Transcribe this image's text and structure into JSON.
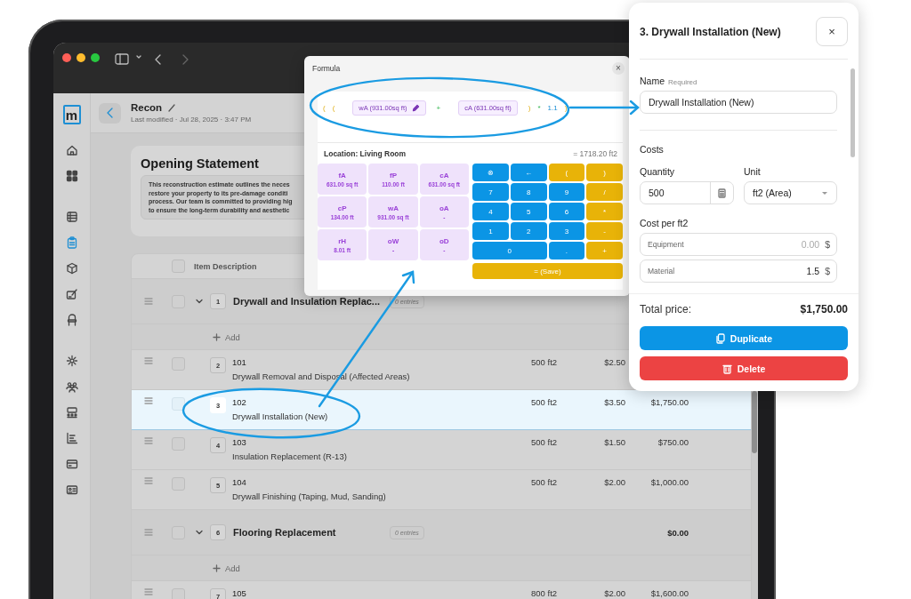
{
  "sidebar": {
    "logo": "m",
    "items": [
      {
        "selected": false
      },
      {
        "selected": false
      },
      {
        "selected": false
      },
      {
        "selected": true
      },
      {
        "selected": false
      },
      {
        "selected": false
      },
      {
        "selected": false
      },
      {
        "selected": false
      },
      {
        "selected": false
      },
      {
        "selected": false
      },
      {
        "selected": false
      },
      {
        "selected": false
      },
      {
        "selected": false
      }
    ]
  },
  "header": {
    "title": "Recon",
    "subtitle": "Last modified · Jul 28, 2025 · 3:47 PM"
  },
  "opening_statement": {
    "title": "Opening Statement",
    "lines": [
      "This reconstruction estimate outlines the neces",
      "restore your property to its pre-damage conditi",
      "process. Our team is committed to providing hig",
      "to ensure the long-term durability and aesthetic"
    ]
  },
  "table": {
    "columns": [
      "Item Description"
    ],
    "header_checked": false,
    "rows": [
      {
        "kind": "group",
        "number": "1",
        "title": "Drywall and Insulation Replac...",
        "entries": "0 entries",
        "expanded": true,
        "checked": false
      },
      {
        "kind": "add",
        "label": "Add"
      },
      {
        "kind": "item",
        "number": "2",
        "code": "101",
        "description": "Drywall Removal and Disposal (Affected Areas)",
        "quantity": "500 ft2",
        "unit_price": "$2.50",
        "checked": false,
        "selected": false
      },
      {
        "kind": "item",
        "number": "3",
        "code": "102",
        "description": "Drywall Installation (New)",
        "quantity": "500 ft2",
        "unit_price": "$3.50",
        "total": "$1,750.00",
        "checked": false,
        "selected": true
      },
      {
        "kind": "item",
        "number": "4",
        "code": "103",
        "description": "Insulation Replacement (R-13)",
        "quantity": "500 ft2",
        "unit_price": "$1.50",
        "total": "$750.00",
        "checked": false,
        "selected": false
      },
      {
        "kind": "item",
        "number": "5",
        "code": "104",
        "description": "Drywall Finishing (Taping, Mud, Sanding)",
        "quantity": "500 ft2",
        "unit_price": "$2.00",
        "total": "$1,000.00",
        "checked": false,
        "selected": false
      },
      {
        "kind": "group",
        "number": "6",
        "title": "Flooring Replacement",
        "entries": "0 entries",
        "total": "$0.00",
        "expanded": true,
        "checked": false
      },
      {
        "kind": "add",
        "label": "Add"
      },
      {
        "kind": "item",
        "number": "7",
        "code": "105",
        "quantity": "800 ft2",
        "unit_price": "$2.00",
        "total": "$1,600.00",
        "checked": false,
        "selected": false
      }
    ]
  },
  "formula": {
    "title": "Formula",
    "close": "×",
    "tokens": [
      {
        "kind": "paren",
        "text": "("
      },
      {
        "kind": "paren",
        "text": "("
      },
      {
        "kind": "variable",
        "text": "wA (931.00sq ft)",
        "editing": true
      },
      {
        "kind": "operator",
        "text": "+"
      },
      {
        "kind": "variable",
        "text": "cA (631.00sq ft)",
        "editing": false
      },
      {
        "kind": "paren",
        "text": ")"
      },
      {
        "kind": "operator",
        "text": "*"
      },
      {
        "kind": "number",
        "text": "1.1"
      },
      {
        "kind": "paren",
        "text": ")"
      }
    ],
    "location": "Location: Living Room",
    "result": "= 1718.20 ft2",
    "variables": [
      {
        "name": "fA",
        "value": "631.00 sq ft"
      },
      {
        "name": "fP",
        "value": "110.00 ft"
      },
      {
        "name": "cA",
        "value": "631.00 sq ft"
      },
      {
        "name": "cP",
        "value": "134.00 ft"
      },
      {
        "name": "wA",
        "value": "931.00 sq ft"
      },
      {
        "name": "oA",
        "value": "-"
      },
      {
        "name": "rH",
        "value": "8.01 ft"
      },
      {
        "name": "oW",
        "value": "-"
      },
      {
        "name": "oD",
        "value": "-"
      }
    ],
    "keys": [
      {
        "kind": "action",
        "label": "⊗",
        "wide": false
      },
      {
        "kind": "action",
        "label": "←",
        "wide": false
      },
      {
        "kind": "operator",
        "label": "(",
        "wide": false
      },
      {
        "kind": "operator",
        "label": ")",
        "wide": false
      },
      {
        "kind": "digit",
        "label": "7",
        "wide": false
      },
      {
        "kind": "digit",
        "label": "8",
        "wide": false
      },
      {
        "kind": "digit",
        "label": "9",
        "wide": false
      },
      {
        "kind": "operator",
        "label": "/",
        "wide": false
      },
      {
        "kind": "digit",
        "label": "4",
        "wide": false
      },
      {
        "kind": "digit",
        "label": "5",
        "wide": false
      },
      {
        "kind": "digit",
        "label": "6",
        "wide": false
      },
      {
        "kind": "operator",
        "label": "*",
        "wide": false
      },
      {
        "kind": "digit",
        "label": "1",
        "wide": false
      },
      {
        "kind": "digit",
        "label": "2",
        "wide": false
      },
      {
        "kind": "digit",
        "label": "3",
        "wide": false
      },
      {
        "kind": "operator",
        "label": "-",
        "wide": false
      },
      {
        "kind": "digit",
        "label": "0",
        "wide": true
      },
      {
        "kind": "digit",
        "label": ".",
        "wide": false
      },
      {
        "kind": "operator",
        "label": "+",
        "wide": false
      }
    ],
    "save": "= (Save)"
  },
  "panel": {
    "title": "3. Drywall Installation (New)",
    "close": "×",
    "name_label": "Name",
    "name_hint": "Required",
    "name_value": "Drywall Installation (New)",
    "costs_heading": "Costs",
    "quantity_label": "Quantity",
    "quantity_value": "500",
    "unit_label": "Unit",
    "unit_value": "ft2 (Area)",
    "cost_heading": "Cost per ft2",
    "cost_fields": [
      {
        "label": "Equipment",
        "placeholder": "0.00",
        "currency": "$"
      },
      {
        "label": "Material",
        "value": "1.5",
        "currency": "$"
      }
    ],
    "total_label": "Total price:",
    "total": "$1,750.00",
    "buttons": [
      {
        "kind": "duplicate",
        "label": "Duplicate"
      },
      {
        "kind": "delete",
        "label": "Delete"
      }
    ]
  }
}
